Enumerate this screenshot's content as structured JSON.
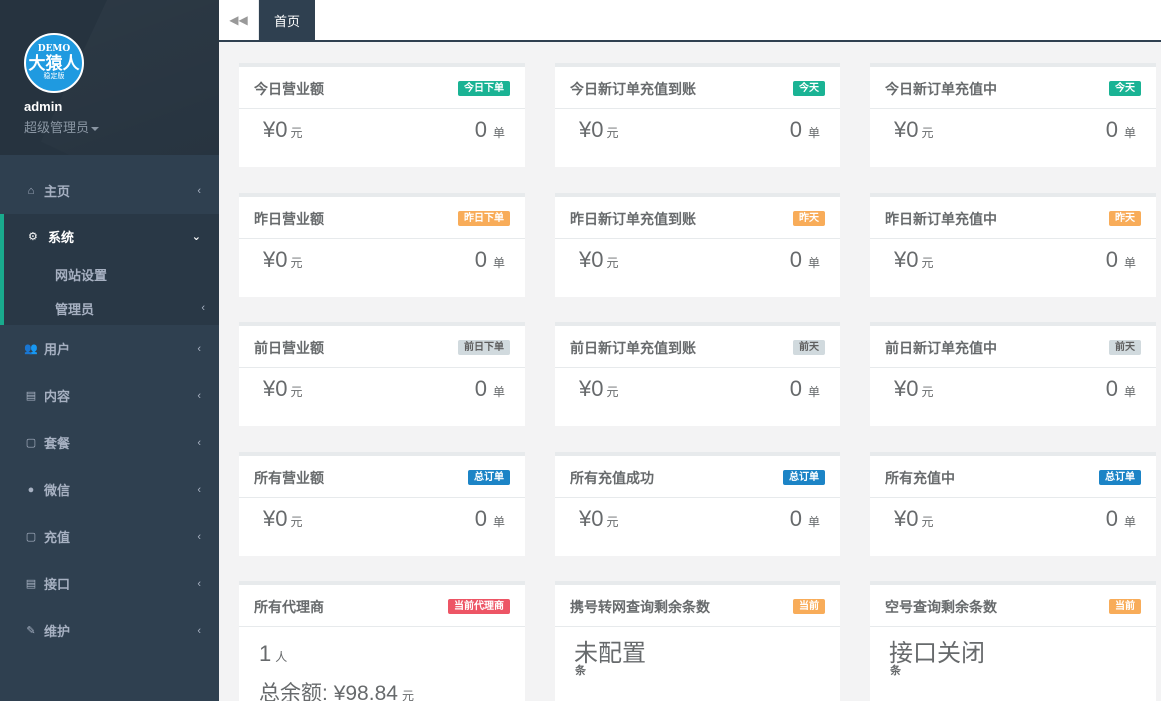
{
  "sidebar": {
    "logo": {
      "demo": "DEMO",
      "brand": "大猿人",
      "version": "稳定版"
    },
    "username": "admin",
    "role": "超级管理员",
    "nav": {
      "home": "主页",
      "system": "系统",
      "system_sub": {
        "site": "网站设置",
        "admin": "管理员"
      },
      "users": "用户",
      "content": "内容",
      "package": "套餐",
      "wechat": "微信",
      "recharge": "充值",
      "api": "接口",
      "maintain": "维护"
    }
  },
  "topbar": {
    "home_tab": "首页"
  },
  "colors": {
    "sidebar": "#2f4050",
    "accent": "#19aa8d",
    "green": "#1ab394",
    "orange": "#f8ac59",
    "gray": "#d1dade",
    "blue": "#1c84c6",
    "red": "#ed5565"
  },
  "units": {
    "yuan": "元",
    "order": "单",
    "person": "人",
    "item": "条",
    "currency": "¥"
  },
  "rows": [
    {
      "cards": [
        {
          "title": "今日营业额",
          "badge": "今日下单",
          "amount": "0",
          "count": "0"
        },
        {
          "title": "今日新订单充值到账",
          "badge": "今天",
          "amount": "0",
          "count": "0"
        },
        {
          "title": "今日新订单充值中",
          "badge": "今天",
          "amount": "0",
          "count": "0"
        }
      ]
    },
    {
      "cards": [
        {
          "title": "昨日营业额",
          "badge": "昨日下单",
          "amount": "0",
          "count": "0"
        },
        {
          "title": "昨日新订单充值到账",
          "badge": "昨天",
          "amount": "0",
          "count": "0"
        },
        {
          "title": "昨日新订单充值中",
          "badge": "昨天",
          "amount": "0",
          "count": "0"
        }
      ]
    },
    {
      "cards": [
        {
          "title": "前日营业额",
          "badge": "前日下单",
          "amount": "0",
          "count": "0"
        },
        {
          "title": "前日新订单充值到账",
          "badge": "前天",
          "amount": "0",
          "count": "0"
        },
        {
          "title": "前日新订单充值中",
          "badge": "前天",
          "amount": "0",
          "count": "0"
        }
      ]
    },
    {
      "cards": [
        {
          "title": "所有营业额",
          "badge": "总订单",
          "amount": "0",
          "count": "0"
        },
        {
          "title": "所有充值成功",
          "badge": "总订单",
          "amount": "0",
          "count": "0"
        },
        {
          "title": "所有充值中",
          "badge": "总订单",
          "amount": "0",
          "count": "0"
        }
      ]
    }
  ],
  "agents": {
    "title": "所有代理商",
    "badge": "当前代理商",
    "count": "1",
    "balance_label": "总余额:",
    "balance": "98.84"
  },
  "portquery": {
    "title": "携号转网查询剩余条数",
    "badge": "当前",
    "value": "未配置"
  },
  "emptyquery": {
    "title": "空号查询剩余条数",
    "badge": "当前",
    "value": "接口关闭"
  }
}
